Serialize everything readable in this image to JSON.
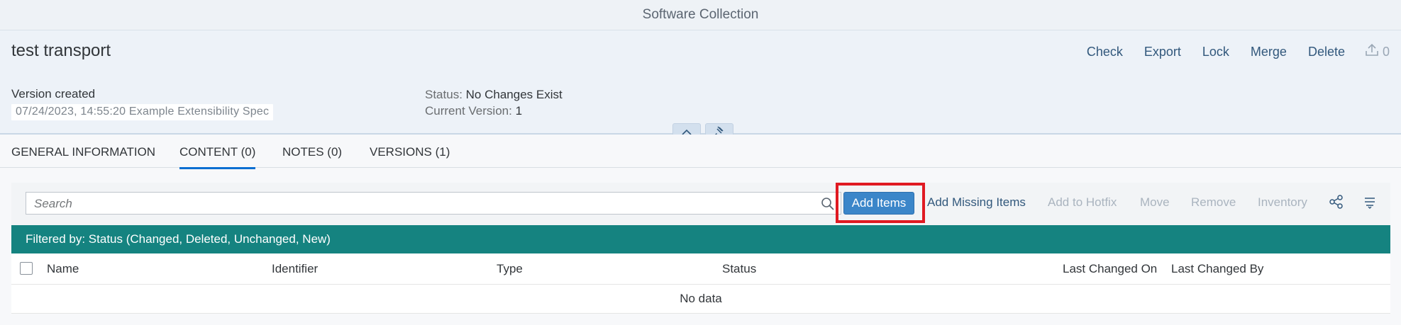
{
  "shell": {
    "title": "Software Collection"
  },
  "header": {
    "title": "test transport",
    "actions": [
      "Check",
      "Export",
      "Lock",
      "Merge",
      "Delete"
    ],
    "upload_count": "0",
    "version_label": "Version created",
    "version_value": "07/24/2023, 14:55:20  Example Extensibility Spec",
    "status_label": "Status:",
    "status_value": "No Changes Exist",
    "current_version_label": "Current Version:",
    "current_version_value": "1"
  },
  "tabs": [
    "GENERAL INFORMATION",
    "CONTENT (0)",
    "NOTES (0)",
    "VERSIONS (1)"
  ],
  "active_tab": "CONTENT (0)",
  "toolbar": {
    "search_placeholder": "Search",
    "add_items": "Add Items",
    "add_missing_items": "Add Missing Items",
    "add_to_hotfix": "Add to Hotfix",
    "move": "Move",
    "remove": "Remove",
    "inventory": "Inventory"
  },
  "filter": {
    "text": "Filtered by: Status (Changed, Deleted, Unchanged, New)"
  },
  "table": {
    "columns": [
      "Name",
      "Identifier",
      "Type",
      "Status",
      "Last Changed On",
      "Last Changed By"
    ],
    "empty_text": "No data"
  },
  "colors": {
    "accent": "#0a6ed1",
    "filter_bar": "#158380",
    "primary_button": "#3b86c9",
    "highlight_frame": "#e01a22"
  }
}
